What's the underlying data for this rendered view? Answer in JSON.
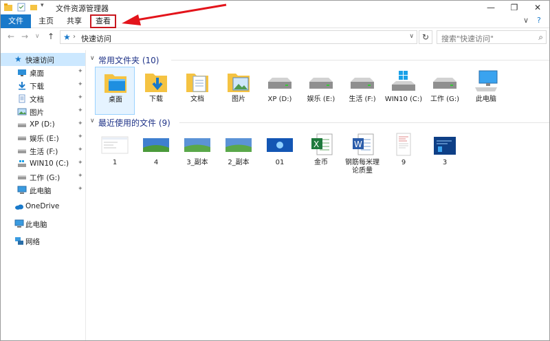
{
  "window": {
    "title": "文件资源管理器",
    "minimize": "—",
    "maximize": "❐",
    "close": "✕"
  },
  "ribbon": {
    "tabs": [
      {
        "label": "文件"
      },
      {
        "label": "主页"
      },
      {
        "label": "共享"
      },
      {
        "label": "查看"
      }
    ],
    "collapse": "∨",
    "help": "?"
  },
  "nav": {
    "back": "←",
    "forward": "→",
    "recent": "∨",
    "up": "↑",
    "location": "快速访问",
    "separator": "›",
    "search_placeholder": "搜索\"快速访问\"",
    "refresh": "↻",
    "dropdown": "∨"
  },
  "sidebar": {
    "quick_access": "快速访问",
    "items": [
      {
        "label": "桌面",
        "icon": "desktop-icon"
      },
      {
        "label": "下载",
        "icon": "download-icon"
      },
      {
        "label": "文档",
        "icon": "document-icon"
      },
      {
        "label": "图片",
        "icon": "picture-icon"
      },
      {
        "label": "XP (D:)",
        "icon": "drive-icon"
      },
      {
        "label": "娱乐 (E:)",
        "icon": "drive-icon"
      },
      {
        "label": "生活 (F:)",
        "icon": "drive-icon"
      },
      {
        "label": "WIN10 (C:)",
        "icon": "windows-drive-icon"
      },
      {
        "label": "工作 (G:)",
        "icon": "drive-icon"
      },
      {
        "label": "此电脑",
        "icon": "computer-icon"
      }
    ],
    "pin": "📌",
    "onedrive": "OneDrive",
    "this_pc": "此电脑",
    "network": "网络"
  },
  "frequent": {
    "header": "常用文件夹 (10)",
    "items": [
      {
        "label": "桌面"
      },
      {
        "label": "下载"
      },
      {
        "label": "文档"
      },
      {
        "label": "图片"
      },
      {
        "label": "XP (D:)"
      },
      {
        "label": "娱乐 (E:)"
      },
      {
        "label": "生活 (F:)"
      },
      {
        "label": "WIN10 (C:)"
      },
      {
        "label": "工作 (G:)"
      },
      {
        "label": "此电脑"
      }
    ]
  },
  "recent": {
    "header": "最近使用的文件 (9)",
    "items": [
      {
        "label": "1"
      },
      {
        "label": "4"
      },
      {
        "label": "3_副本"
      },
      {
        "label": "2_副本"
      },
      {
        "label": "01"
      },
      {
        "label": "金币"
      },
      {
        "label": "钢筋每米理论质量"
      },
      {
        "label": "9"
      },
      {
        "label": "3"
      }
    ]
  },
  "colors": {
    "accent": "#1979ca",
    "highlight": "#c8161d",
    "selection": "#cce8ff"
  }
}
